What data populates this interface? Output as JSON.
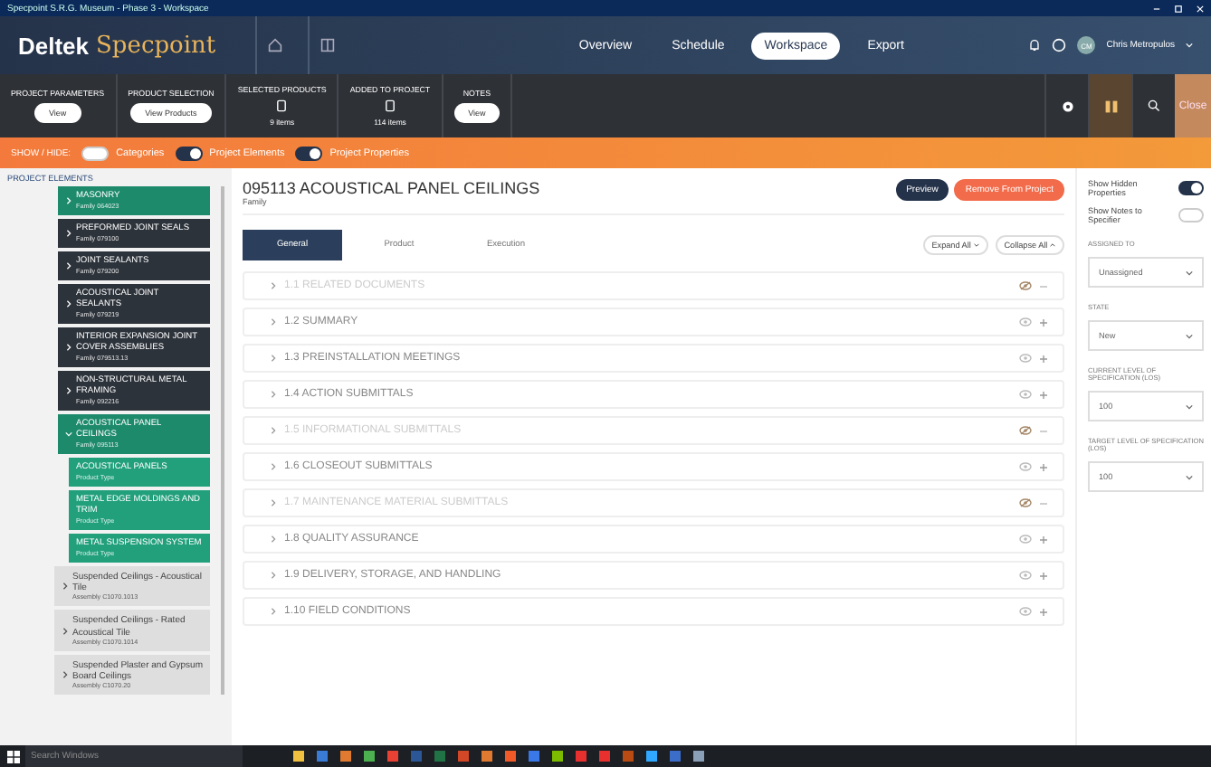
{
  "window": {
    "title": "Specpoint S.R.G. Museum - Phase 3 - Workspace"
  },
  "nav": {
    "logo_left": "Deltek",
    "logo_right": "Specpoint",
    "items": [
      {
        "label": "Overview",
        "selected": false
      },
      {
        "label": "Schedule",
        "selected": false
      },
      {
        "label": "Workspace",
        "selected": true
      },
      {
        "label": "Export",
        "selected": false
      }
    ],
    "user": {
      "initials": "CM",
      "name": "Chris Metropulos"
    }
  },
  "toolbar": {
    "groups": [
      {
        "kind": "button",
        "label": "PROJECT PARAMETERS",
        "button": "View"
      },
      {
        "kind": "button",
        "label": "PRODUCT SELECTION",
        "button": "View Products"
      },
      {
        "kind": "count",
        "label": "SELECTED PRODUCTS",
        "count": "9 items"
      },
      {
        "kind": "count",
        "label": "ADDED TO PROJECT",
        "count": "114 items"
      },
      {
        "kind": "button",
        "label": "NOTES",
        "button": "View"
      }
    ],
    "close": "Close"
  },
  "showbar": {
    "label": "SHOW / HIDE:",
    "toggles": [
      {
        "label": "Categories",
        "on": false
      },
      {
        "label": "Project Elements",
        "on": true
      },
      {
        "label": "Project Properties",
        "on": true
      }
    ]
  },
  "sidebar": {
    "heading": "PROJECT ELEMENTS",
    "items": [
      {
        "kind": "family",
        "title": "MASONRY",
        "sub": "Family 064023",
        "selected": true,
        "expanded": false
      },
      {
        "kind": "family",
        "title": "PREFORMED JOINT SEALS",
        "sub": "Family 079100",
        "selected": false,
        "expanded": false
      },
      {
        "kind": "family",
        "title": "JOINT SEALANTS",
        "sub": "Family 079200",
        "selected": false,
        "expanded": false
      },
      {
        "kind": "family",
        "title": "ACOUSTICAL JOINT SEALANTS",
        "sub": "Family 079219",
        "selected": false,
        "expanded": false
      },
      {
        "kind": "family",
        "title": "INTERIOR EXPANSION JOINT COVER ASSEMBLIES",
        "sub": "Family 079513.13",
        "selected": false,
        "expanded": false
      },
      {
        "kind": "family",
        "title": "NON-STRUCTURAL METAL FRAMING",
        "sub": "Family 092216",
        "selected": false,
        "expanded": false
      },
      {
        "kind": "family",
        "title": "ACOUSTICAL PANEL CEILINGS",
        "sub": "Family 095113",
        "selected": true,
        "expanded": true
      },
      {
        "kind": "product",
        "title": "ACOUSTICAL PANELS",
        "sub": "Product Type"
      },
      {
        "kind": "product",
        "title": "METAL EDGE MOLDINGS AND TRIM",
        "sub": "Product Type"
      },
      {
        "kind": "product",
        "title": "METAL SUSPENSION SYSTEM",
        "sub": "Product Type"
      },
      {
        "kind": "assembly",
        "title": "Suspended Ceilings - Acoustical Tile",
        "sub": "Assembly C1070.1013"
      },
      {
        "kind": "assembly",
        "title": "Suspended Ceilings - Rated Acoustical Tile",
        "sub": "Assembly C1070.1014"
      },
      {
        "kind": "assembly",
        "title": "Suspended Plaster and Gypsum Board Ceilings",
        "sub": "Assembly C1070.20"
      }
    ]
  },
  "main": {
    "title": "095113 ACOUSTICAL PANEL CEILINGS",
    "subtitle": "Family",
    "preview": "Preview",
    "remove": "Remove From Project",
    "tabs": [
      {
        "label": "General",
        "selected": true
      },
      {
        "label": "Product",
        "selected": false
      },
      {
        "label": "Execution",
        "selected": false
      }
    ],
    "expand_all": "Expand All",
    "collapse_all": "Collapse All",
    "sections": [
      {
        "number": "1.1",
        "title": "RELATED DOCUMENTS",
        "hidden": true
      },
      {
        "number": "1.2",
        "title": "SUMMARY",
        "hidden": false
      },
      {
        "number": "1.3",
        "title": "PREINSTALLATION MEETINGS",
        "hidden": false
      },
      {
        "number": "1.4",
        "title": "ACTION SUBMITTALS",
        "hidden": false
      },
      {
        "number": "1.5",
        "title": "INFORMATIONAL SUBMITTALS",
        "hidden": true
      },
      {
        "number": "1.6",
        "title": "CLOSEOUT SUBMITTALS",
        "hidden": false
      },
      {
        "number": "1.7",
        "title": "MAINTENANCE MATERIAL SUBMITTALS",
        "hidden": true
      },
      {
        "number": "1.8",
        "title": "QUALITY ASSURANCE",
        "hidden": false
      },
      {
        "number": "1.9",
        "title": "DELIVERY, STORAGE, AND HANDLING",
        "hidden": false
      },
      {
        "number": "1.10",
        "title": "FIELD CONDITIONS",
        "hidden": false
      }
    ]
  },
  "properties": {
    "toggles": [
      {
        "label": "Show Hidden Properties",
        "on": true
      },
      {
        "label": "Show Notes to Specifier",
        "on": false
      }
    ],
    "fields": [
      {
        "label": "ASSIGNED TO",
        "value": "Unassigned"
      },
      {
        "label": "STATE",
        "value": "New"
      },
      {
        "label": "CURRENT LEVEL OF SPECIFICATION (LOS)",
        "value": "100"
      },
      {
        "label": "TARGET LEVEL OF SPECIFICATION (LOS)",
        "value": "100"
      }
    ]
  },
  "taskbar": {
    "search": "Search Windows",
    "apps": [
      {
        "color": "#f0c040"
      },
      {
        "color": "#3a7bd5"
      },
      {
        "color": "#e07a30"
      },
      {
        "color": "#4caf50"
      },
      {
        "color": "#e94235"
      },
      {
        "color": "#2b5797"
      },
      {
        "color": "#217346"
      },
      {
        "color": "#d24726"
      },
      {
        "color": "#e07a30"
      },
      {
        "color": "#f05a28"
      },
      {
        "color": "#3b78e7"
      },
      {
        "color": "#7cbb00"
      },
      {
        "color": "#e8312f"
      },
      {
        "color": "#e8312f"
      },
      {
        "color": "#b84b13"
      },
      {
        "color": "#31a8ff"
      },
      {
        "color": "#3c6ec9"
      },
      {
        "color": "#8aa0b8"
      }
    ]
  }
}
